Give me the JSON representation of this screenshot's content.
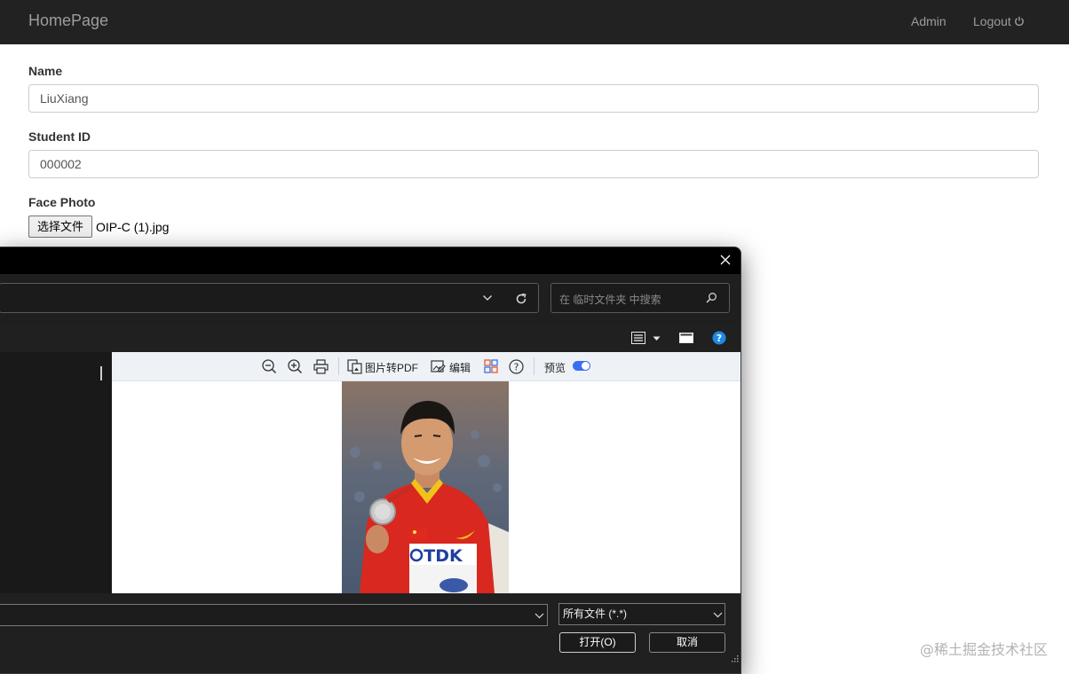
{
  "navbar": {
    "brand": "HomePage",
    "admin": "Admin",
    "logout": "Logout"
  },
  "form": {
    "name_label": "Name",
    "name_value": "LiuXiang",
    "student_id_label": "Student ID",
    "student_id_value": "000002",
    "face_photo_label": "Face Photo",
    "choose_file_button": "选择文件",
    "chosen_file_name": "OIP-C (1).jpg"
  },
  "file_dialog": {
    "search_placeholder": "在 临时文件夹 中搜索",
    "preview_toolbar": {
      "image_to_pdf": "图片转PDF",
      "edit": "编辑",
      "preview_label": "预览",
      "preview_enabled": true
    },
    "file_type": "所有文件 (*.*)",
    "open_button": "打开(O)",
    "cancel_button": "取消",
    "icons": [
      "close-icon",
      "chevron-down-icon",
      "refresh-icon",
      "search-icon",
      "view-list-icon",
      "preview-pane-icon",
      "help-icon",
      "zoom-out-icon",
      "zoom-in-icon",
      "print-icon",
      "image-to-pdf-icon",
      "edit-icon",
      "apps-icon",
      "question-icon"
    ]
  },
  "colors": {
    "navbar_bg": "#222222",
    "dialog_bg": "#1f1f1f",
    "toggle_accent": "#3a6ff0",
    "help_blue": "#1e88e5"
  },
  "watermark": "@稀土掘金技术社区"
}
